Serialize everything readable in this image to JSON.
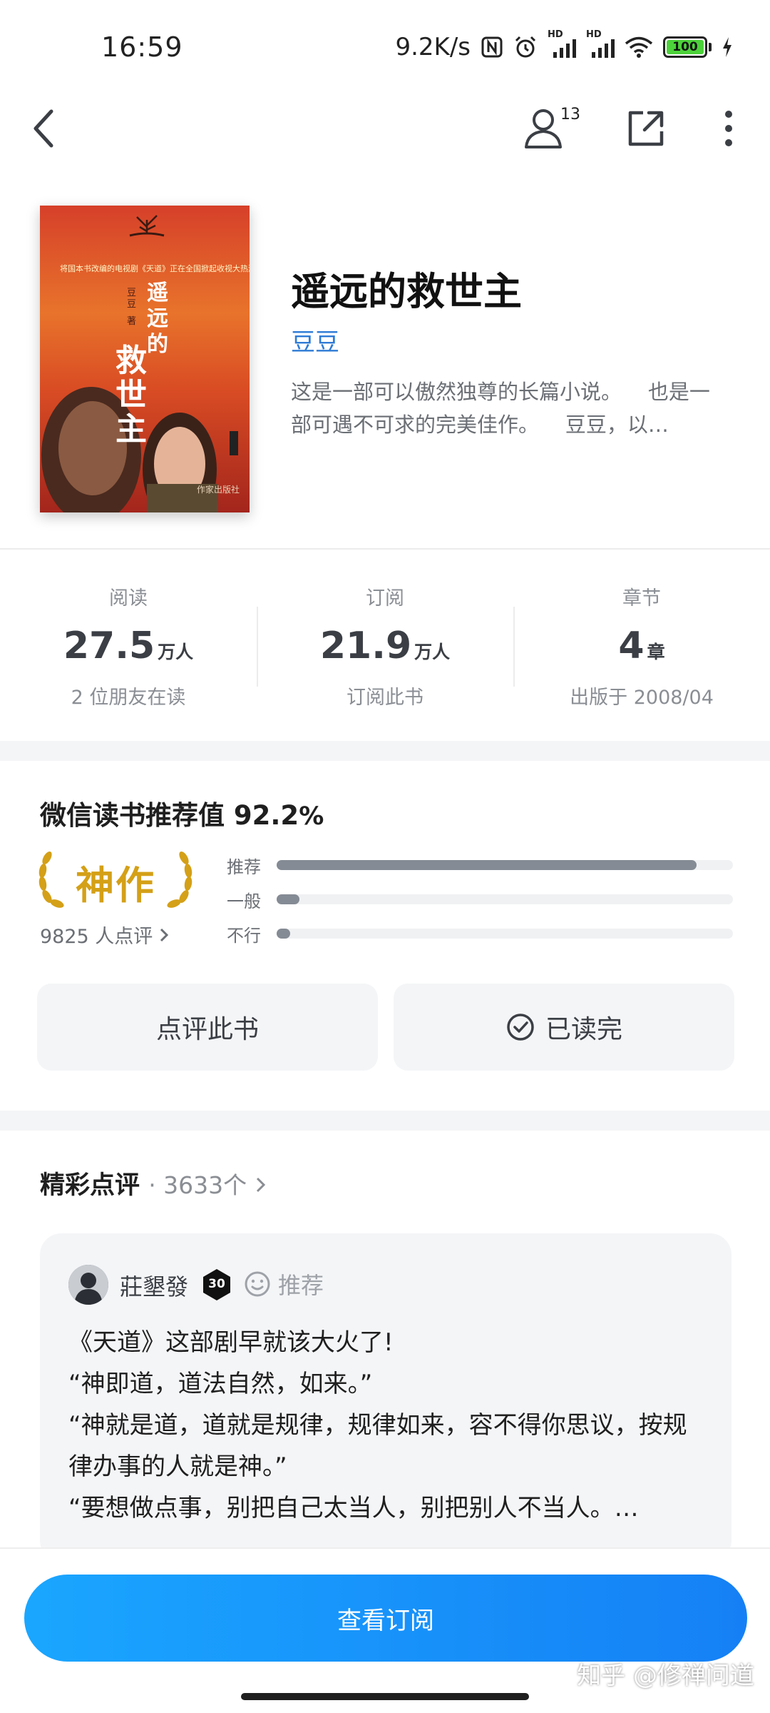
{
  "status_bar": {
    "time": "16:59",
    "speed": "9.2K/s",
    "battery": "100",
    "hd_label": "HD"
  },
  "nav": {
    "back_icon": "chevron-left-icon",
    "friends_count": "13",
    "share_icon": "share-icon",
    "more_icon": "more-vertical-icon"
  },
  "book": {
    "title": "遥远的救世主",
    "author": "豆豆",
    "description": "这是一部可以傲然独尊的长篇小说。    也是一部可遇不可求的完美佳作。    豆豆，以…",
    "cover": {
      "top_text": "将国本书改编的电视剧《天道》正在全国掀起收视大热潮",
      "title_text": "遥远的救世主",
      "author_text": "豆豆 著",
      "publisher_text": "作家出版社"
    }
  },
  "stats": [
    {
      "label": "阅读",
      "value": "27.5",
      "unit": "万人",
      "sub": "2 位朋友在读"
    },
    {
      "label": "订阅",
      "value": "21.9",
      "unit": "万人",
      "sub": "订阅此书"
    },
    {
      "label": "章节",
      "value": "4",
      "unit": "章",
      "sub": "出版于 2008/04"
    }
  ],
  "rating": {
    "title": "微信读书推荐值",
    "value": "92.2",
    "pct_sign": "%",
    "badge": "神作",
    "review_count": "9825 人点评",
    "bars": [
      {
        "label": "推荐",
        "fraction": 0.92
      },
      {
        "label": "一般",
        "fraction": 0.05
      },
      {
        "label": "不行",
        "fraction": 0.03
      }
    ]
  },
  "actions": {
    "review_label": "点评此书",
    "finished_label": "已读完"
  },
  "reviews": {
    "heading": "精彩点评",
    "count": "· 3633个",
    "first": {
      "name": "莊墾發",
      "level": "30",
      "tag": "推荐",
      "lines": [
        "《天道》这部剧早就该大火了!",
        "“神即道，道法自然，如来。”",
        "“神就是道，道就是规律，规律如来，容不得你思议，按规律办事的人就是神。”",
        "“要想做点事，别把自己太当人，别把别人不当人。…"
      ]
    }
  },
  "bottom": {
    "cta_label": "查看订阅",
    "watermark": "知乎 @修禅问道"
  },
  "colors": {
    "accent": "#2e7bd6",
    "cta_start": "#1aa6ff",
    "cta_end": "#1580f5",
    "gold": "#d4a017",
    "bar_fill": "#858b94"
  }
}
